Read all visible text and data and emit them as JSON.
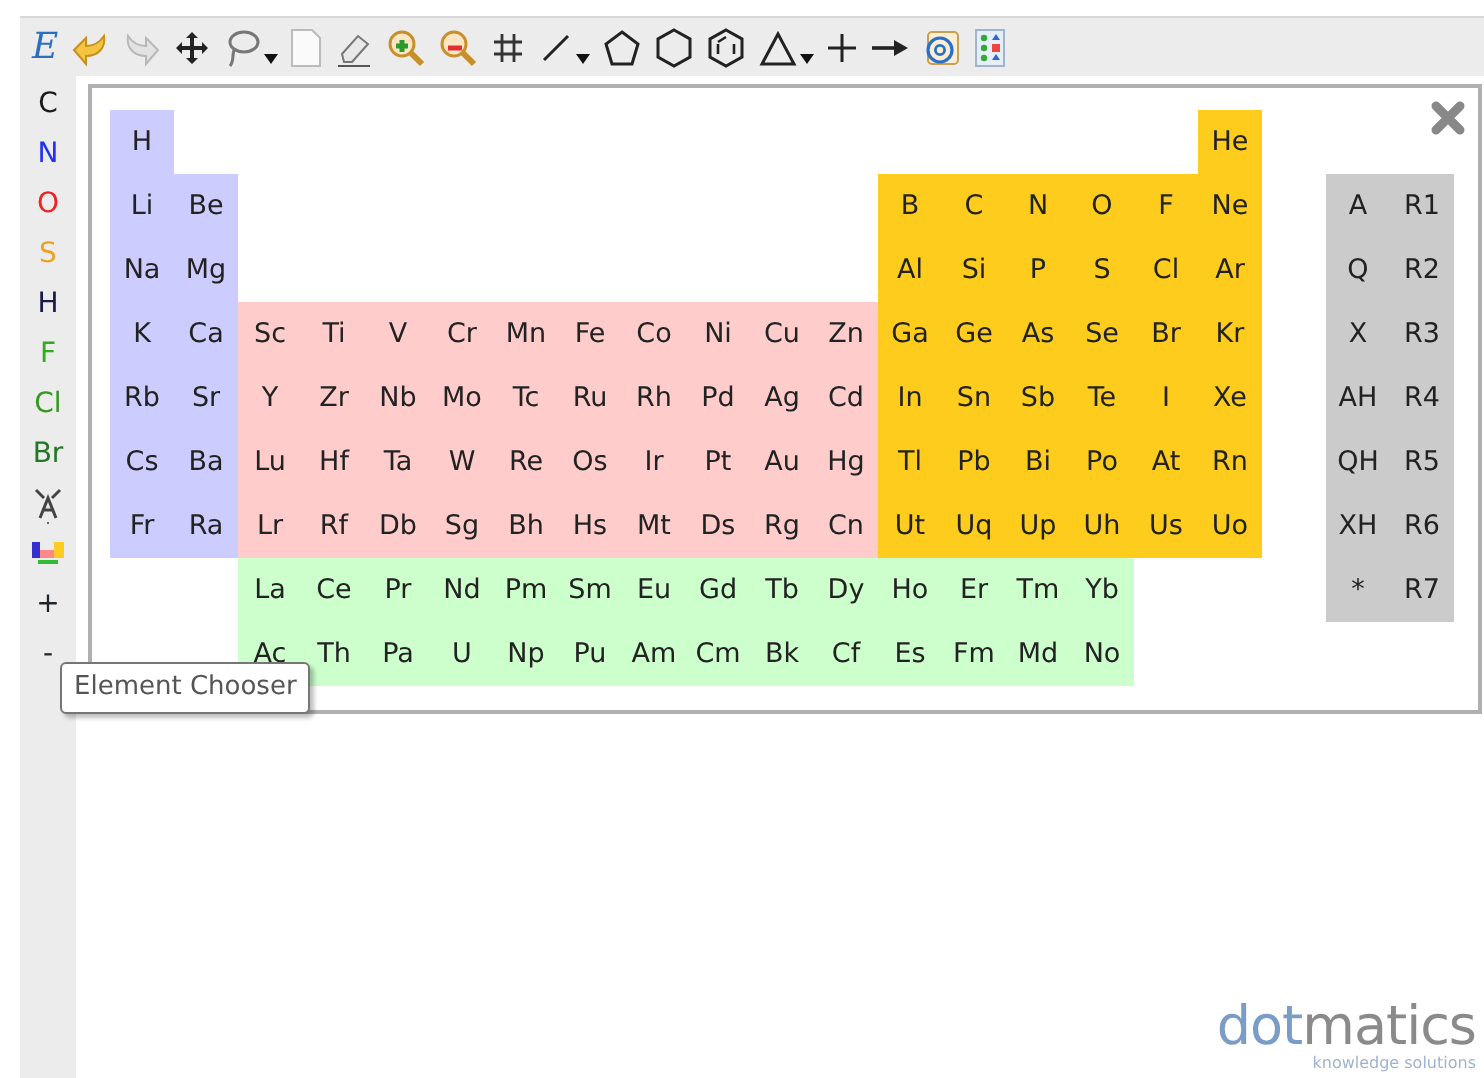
{
  "toolbar": {
    "mode_label": "E"
  },
  "atom_bar": {
    "atoms": [
      {
        "symbol": "C",
        "color": "#1a1a1a"
      },
      {
        "symbol": "N",
        "color": "#2233ee"
      },
      {
        "symbol": "O",
        "color": "#ee2222"
      },
      {
        "symbol": "S",
        "color": "#f0a020"
      },
      {
        "symbol": "H",
        "color": "#1a1a4a"
      },
      {
        "symbol": "F",
        "color": "#33aa22"
      },
      {
        "symbol": "Cl",
        "color": "#339922"
      },
      {
        "symbol": "Br",
        "color": "#227722"
      }
    ],
    "zoom_labels": [
      "+",
      "-"
    ]
  },
  "periodic_table": {
    "periods": [
      [
        {
          "symbol": "H",
          "kind": "s"
        },
        {
          "symbol": "He",
          "kind": "p"
        }
      ],
      [
        {
          "symbol": "Li",
          "kind": "s"
        },
        {
          "symbol": "Be",
          "kind": "s"
        },
        {
          "symbol": "B",
          "kind": "p"
        },
        {
          "symbol": "C",
          "kind": "p"
        },
        {
          "symbol": "N",
          "kind": "p"
        },
        {
          "symbol": "O",
          "kind": "p"
        },
        {
          "symbol": "F",
          "kind": "p"
        },
        {
          "symbol": "Ne",
          "kind": "p"
        }
      ],
      [
        {
          "symbol": "Na",
          "kind": "s"
        },
        {
          "symbol": "Mg",
          "kind": "s"
        },
        {
          "symbol": "Al",
          "kind": "p"
        },
        {
          "symbol": "Si",
          "kind": "p"
        },
        {
          "symbol": "P",
          "kind": "p"
        },
        {
          "symbol": "S",
          "kind": "p"
        },
        {
          "symbol": "Cl",
          "kind": "p"
        },
        {
          "symbol": "Ar",
          "kind": "p"
        }
      ],
      [
        {
          "symbol": "K",
          "kind": "s"
        },
        {
          "symbol": "Ca",
          "kind": "s"
        },
        {
          "symbol": "Sc",
          "kind": "d"
        },
        {
          "symbol": "Ti",
          "kind": "d"
        },
        {
          "symbol": "V",
          "kind": "d"
        },
        {
          "symbol": "Cr",
          "kind": "d"
        },
        {
          "symbol": "Mn",
          "kind": "d"
        },
        {
          "symbol": "Fe",
          "kind": "d"
        },
        {
          "symbol": "Co",
          "kind": "d"
        },
        {
          "symbol": "Ni",
          "kind": "d"
        },
        {
          "symbol": "Cu",
          "kind": "d"
        },
        {
          "symbol": "Zn",
          "kind": "d"
        },
        {
          "symbol": "Ga",
          "kind": "p"
        },
        {
          "symbol": "Ge",
          "kind": "p"
        },
        {
          "symbol": "As",
          "kind": "p"
        },
        {
          "symbol": "Se",
          "kind": "p"
        },
        {
          "symbol": "Br",
          "kind": "p"
        },
        {
          "symbol": "Kr",
          "kind": "p"
        }
      ],
      [
        {
          "symbol": "Rb",
          "kind": "s"
        },
        {
          "symbol": "Sr",
          "kind": "s"
        },
        {
          "symbol": "Y",
          "kind": "d"
        },
        {
          "symbol": "Zr",
          "kind": "d"
        },
        {
          "symbol": "Nb",
          "kind": "d"
        },
        {
          "symbol": "Mo",
          "kind": "d"
        },
        {
          "symbol": "Tc",
          "kind": "d"
        },
        {
          "symbol": "Ru",
          "kind": "d"
        },
        {
          "symbol": "Rh",
          "kind": "d"
        },
        {
          "symbol": "Pd",
          "kind": "d"
        },
        {
          "symbol": "Ag",
          "kind": "d"
        },
        {
          "symbol": "Cd",
          "kind": "d"
        },
        {
          "symbol": "In",
          "kind": "p"
        },
        {
          "symbol": "Sn",
          "kind": "p"
        },
        {
          "symbol": "Sb",
          "kind": "p"
        },
        {
          "symbol": "Te",
          "kind": "p"
        },
        {
          "symbol": "I",
          "kind": "p"
        },
        {
          "symbol": "Xe",
          "kind": "p"
        }
      ],
      [
        {
          "symbol": "Cs",
          "kind": "s"
        },
        {
          "symbol": "Ba",
          "kind": "s"
        },
        {
          "symbol": "Lu",
          "kind": "d"
        },
        {
          "symbol": "Hf",
          "kind": "d"
        },
        {
          "symbol": "Ta",
          "kind": "d"
        },
        {
          "symbol": "W",
          "kind": "d"
        },
        {
          "symbol": "Re",
          "kind": "d"
        },
        {
          "symbol": "Os",
          "kind": "d"
        },
        {
          "symbol": "Ir",
          "kind": "d"
        },
        {
          "symbol": "Pt",
          "kind": "d"
        },
        {
          "symbol": "Au",
          "kind": "d"
        },
        {
          "symbol": "Hg",
          "kind": "d"
        },
        {
          "symbol": "Tl",
          "kind": "p"
        },
        {
          "symbol": "Pb",
          "kind": "p"
        },
        {
          "symbol": "Bi",
          "kind": "p"
        },
        {
          "symbol": "Po",
          "kind": "p"
        },
        {
          "symbol": "At",
          "kind": "p"
        },
        {
          "symbol": "Rn",
          "kind": "p"
        }
      ],
      [
        {
          "symbol": "Fr",
          "kind": "s"
        },
        {
          "symbol": "Ra",
          "kind": "s"
        },
        {
          "symbol": "Lr",
          "kind": "d"
        },
        {
          "symbol": "Rf",
          "kind": "d"
        },
        {
          "symbol": "Db",
          "kind": "d"
        },
        {
          "symbol": "Sg",
          "kind": "d"
        },
        {
          "symbol": "Bh",
          "kind": "d"
        },
        {
          "symbol": "Hs",
          "kind": "d"
        },
        {
          "symbol": "Mt",
          "kind": "d"
        },
        {
          "symbol": "Ds",
          "kind": "d"
        },
        {
          "symbol": "Rg",
          "kind": "d"
        },
        {
          "symbol": "Cn",
          "kind": "d"
        },
        {
          "symbol": "Ut",
          "kind": "p"
        },
        {
          "symbol": "Uq",
          "kind": "p"
        },
        {
          "symbol": "Up",
          "kind": "p"
        },
        {
          "symbol": "Uh",
          "kind": "p"
        },
        {
          "symbol": "Us",
          "kind": "p"
        },
        {
          "symbol": "Uo",
          "kind": "p"
        }
      ]
    ],
    "f_block": [
      [
        {
          "symbol": "La",
          "kind": "f"
        },
        {
          "symbol": "Ce",
          "kind": "f"
        },
        {
          "symbol": "Pr",
          "kind": "f"
        },
        {
          "symbol": "Nd",
          "kind": "f"
        },
        {
          "symbol": "Pm",
          "kind": "f"
        },
        {
          "symbol": "Sm",
          "kind": "f"
        },
        {
          "symbol": "Eu",
          "kind": "f"
        },
        {
          "symbol": "Gd",
          "kind": "f"
        },
        {
          "symbol": "Tb",
          "kind": "f"
        },
        {
          "symbol": "Dy",
          "kind": "f"
        },
        {
          "symbol": "Ho",
          "kind": "f"
        },
        {
          "symbol": "Er",
          "kind": "f"
        },
        {
          "symbol": "Tm",
          "kind": "f"
        },
        {
          "symbol": "Yb",
          "kind": "f"
        }
      ],
      [
        {
          "symbol": "Ac",
          "kind": "f"
        },
        {
          "symbol": "Th",
          "kind": "f"
        },
        {
          "symbol": "Pa",
          "kind": "f"
        },
        {
          "symbol": "U",
          "kind": "f"
        },
        {
          "symbol": "Np",
          "kind": "f"
        },
        {
          "symbol": "Pu",
          "kind": "f"
        },
        {
          "symbol": "Am",
          "kind": "f"
        },
        {
          "symbol": "Cm",
          "kind": "f"
        },
        {
          "symbol": "Bk",
          "kind": "f"
        },
        {
          "symbol": "Cf",
          "kind": "f"
        },
        {
          "symbol": "Es",
          "kind": "f"
        },
        {
          "symbol": "Fm",
          "kind": "f"
        },
        {
          "symbol": "Md",
          "kind": "f"
        },
        {
          "symbol": "No",
          "kind": "f"
        }
      ]
    ],
    "query_atoms": [
      [
        "A",
        "R1"
      ],
      [
        "Q",
        "R2"
      ],
      [
        "X",
        "R3"
      ],
      [
        "AH",
        "R4"
      ],
      [
        "QH",
        "R5"
      ],
      [
        "XH",
        "R6"
      ],
      [
        "*",
        "R7"
      ]
    ]
  },
  "tooltip": "Element Chooser",
  "logo": {
    "name_first": "dot",
    "name_rest": "matics",
    "tagline": "knowledge solutions"
  }
}
